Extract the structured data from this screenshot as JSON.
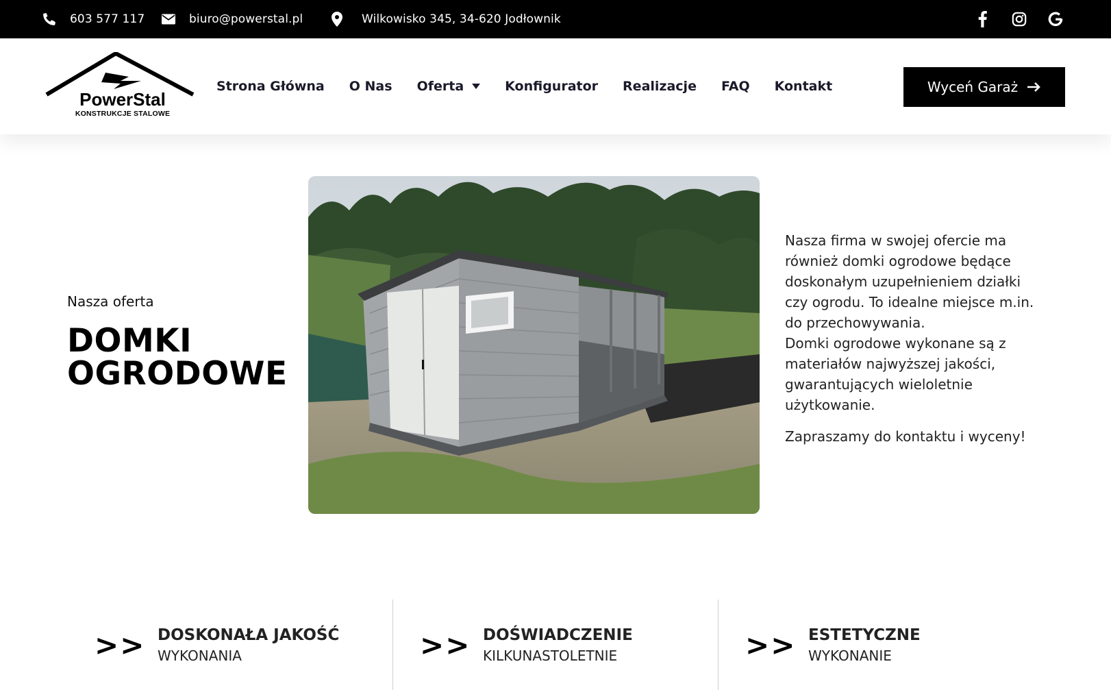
{
  "topbar": {
    "phone": "603 577 117",
    "email": "biuro@powerstal.pl",
    "address": "Wilkowisko 345, 34-620 Jodłownik",
    "icons": [
      "phone-icon",
      "envelope-icon",
      "map-marker-icon",
      "facebook-icon",
      "instagram-icon",
      "google-icon"
    ]
  },
  "logo": {
    "name": "PowerStal",
    "tagline": "KONSTRUKCJE STALOWE"
  },
  "nav": {
    "items": [
      {
        "label": "Strona Główna"
      },
      {
        "label": "O Nas"
      },
      {
        "label": "Oferta"
      },
      {
        "label": "Konfigurator"
      },
      {
        "label": "Realizacje"
      },
      {
        "label": "FAQ"
      },
      {
        "label": "Kontakt"
      }
    ],
    "cta_label": "Wyceń Garaż"
  },
  "hero": {
    "eyebrow": "Nasza oferta",
    "title_line1": "DOMKI",
    "title_line2": "OGRODOWE",
    "paragraph1": "Nasza firma w swojej ofercie ma również domki ogrodowe będące doskonałym uzupełnieniem działki czy ogrodu. To idealne miejsce m.in. do przechowywania.",
    "paragraph2": "Domki ogrodowe wykonane są z materiałów najwyższej jakości, gwarantujących wieloletnie użytkowanie.",
    "paragraph3": "Zapraszamy do kontaktu i wyceny!"
  },
  "features": [
    {
      "arrows": ">>",
      "title": "DOSKONAŁA JAKOŚĆ",
      "subtitle": "WYKONANIA"
    },
    {
      "arrows": ">>",
      "title": "DOŚWIADCZENIE",
      "subtitle": "KILKUNASTOLETNIE"
    },
    {
      "arrows": ">>",
      "title": "ESTETYCZNE",
      "subtitle": "WYKONANIE"
    }
  ],
  "colors": {
    "topbar_bg": "#000000",
    "nav_text": "#1a1a2a",
    "cta_bg": "#000000",
    "divider": "#cfcfcf"
  }
}
